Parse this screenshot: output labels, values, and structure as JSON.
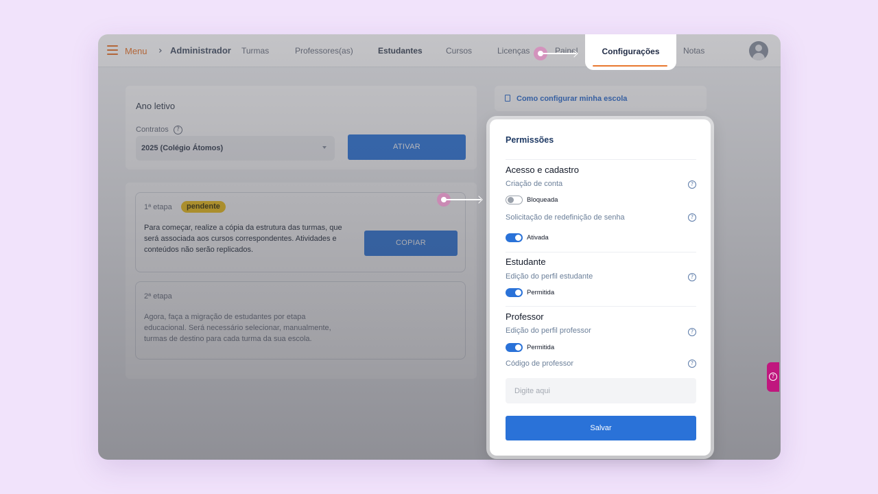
{
  "topbar": {
    "menu_label": "Menu",
    "breadcrumb": "Administrador",
    "nav": [
      "Turmas",
      "Professores(as)",
      "Estudantes",
      "Cursos",
      "Licenças",
      "Painel",
      "Configurações",
      "Notas"
    ],
    "active_tab": "Configurações"
  },
  "ano_letivo": {
    "title": "Ano letivo",
    "contratos_label": "Contratos",
    "select_value": "2025 (Colégio Átomos)",
    "activate_label": "ATIVAR"
  },
  "etapas": {
    "step1_title": "1ª etapa",
    "step1_badge": "pendente",
    "step1_desc": "Para começar, realize a cópia da estrutura das turmas, que será associada aos cursos correspondentes. Atividades e conteúdos não serão replicados.",
    "copy_label": "COPIAR",
    "step2_title": "2ª etapa",
    "step2_desc": "Agora, faça a migração de estudantes por etapa educacional. Será necessário selecionar, manualmente, turmas de destino para cada turma da sua escola."
  },
  "help_link": "Como configurar minha escola",
  "permissoes": {
    "title": "Permissões",
    "acesso": {
      "title": "Acesso e cadastro",
      "criacao_label": "Criação de conta",
      "criacao_state": "Bloqueada",
      "redefinicao_label": "Solicitação de redefinição de senha",
      "redefinicao_state": "Ativada"
    },
    "estudante": {
      "title": "Estudante",
      "edicao_label": "Edição do perfil estudante",
      "edicao_state": "Permitida"
    },
    "professor": {
      "title": "Professor",
      "edicao_label": "Edição do perfil professor",
      "edicao_state": "Permitida",
      "codigo_label": "Código de professor",
      "codigo_placeholder": "Digite aqui"
    },
    "save_label": "Salvar"
  },
  "colors": {
    "accent_orange": "#e8772e",
    "primary_blue": "#2a72d8",
    "badge_yellow": "#f5c518",
    "marker_pink": "#e95cb4",
    "help_magenta": "#c0177e",
    "background_lilac": "#f1e3fb"
  },
  "icons": [
    "hamburger-icon",
    "chevron-right-icon",
    "help-circle-icon",
    "document-icon",
    "user-avatar-icon"
  ]
}
